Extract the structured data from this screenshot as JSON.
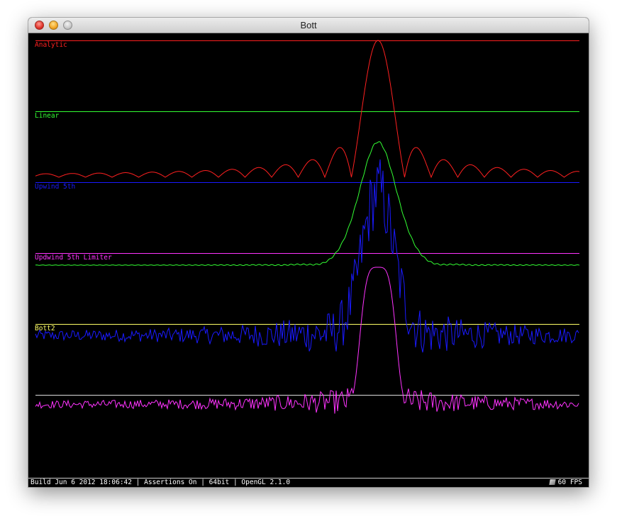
{
  "window": {
    "title": "Bott"
  },
  "plots": [
    {
      "label": "Analytic",
      "color": "#ff2020"
    },
    {
      "label": "Linear",
      "color": "#33ff33"
    },
    {
      "label": "Upwind 5th",
      "color": "#1a1aff"
    },
    {
      "label": "Updwind 5th Limiter",
      "color": "#ff33ff"
    },
    {
      "label": "Bott2",
      "color": "#ffff66"
    }
  ],
  "status": {
    "build": "Build Jun  6 2012 18:06:42 | Assertions On | 64bit | OpenGL 2.1.0",
    "fps": "60 FPS"
  },
  "icons": {
    "close": "close-icon",
    "minimize": "minimize-icon",
    "zoom": "zoom-icon",
    "fps": "fps-icon"
  }
}
